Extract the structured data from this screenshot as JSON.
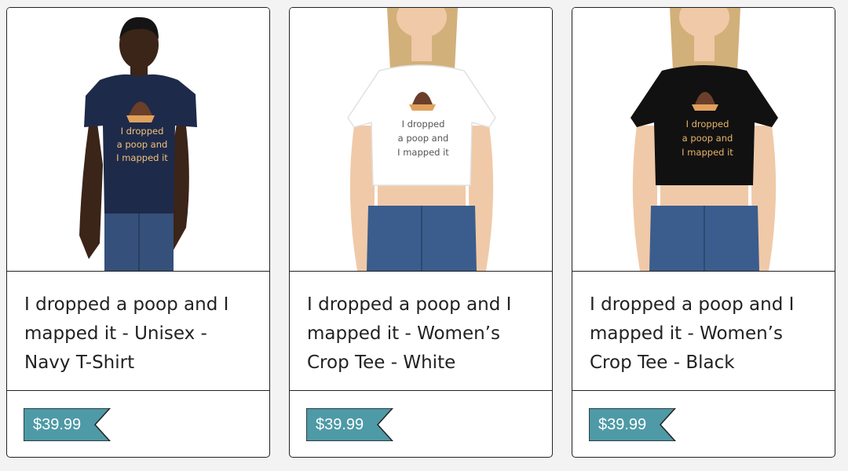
{
  "products": [
    {
      "title": "I dropped a poop and I mapped it - Unisex - Navy T-Shirt",
      "price": "$39.99",
      "model": "male-model",
      "shirt_color": "#1e2a4a",
      "print_color": "#f2c27a",
      "print_lines": [
        "I dropped",
        "a poop and",
        "I mapped it"
      ]
    },
    {
      "title": "I dropped a poop and I mapped it - Women’s Crop Tee - White",
      "price": "$39.99",
      "model": "female-model",
      "shirt_color": "#ffffff",
      "print_color": "#555555",
      "print_lines": [
        "I dropped",
        "a poop and",
        "I mapped it"
      ]
    },
    {
      "title": "I dropped a poop and I mapped it - Women’s Crop Tee - Black",
      "price": "$39.99",
      "model": "female-model",
      "shirt_color": "#111111",
      "print_color": "#e7b46a",
      "print_lines": [
        "I dropped",
        "a poop and",
        "I mapped it"
      ]
    }
  ],
  "colors": {
    "price_tag": "#4e9aa6",
    "border": "#222222"
  }
}
